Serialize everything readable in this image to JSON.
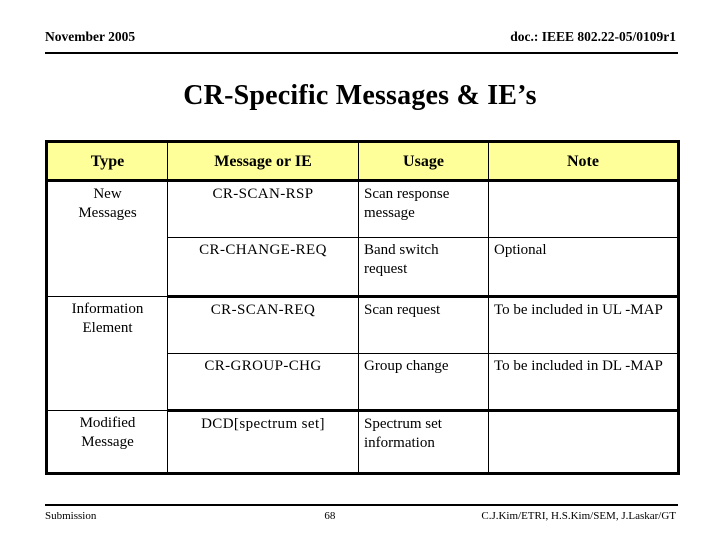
{
  "header": {
    "left": "November 2005",
    "right": "doc.: IEEE 802.22-05/0109r1"
  },
  "title": "CR-Specific Messages & IE’s",
  "table": {
    "columns": [
      "Type",
      "Message or IE",
      "Usage",
      "Note"
    ],
    "groups": [
      {
        "type": "New\nMessages",
        "type_line1": "New",
        "type_line2": "Messages",
        "rows": [
          {
            "message": "CR-SCAN-RSP",
            "usage": "Scan response message",
            "note": ""
          },
          {
            "message": "CR-CHANGE-REQ",
            "usage": "Band switch request",
            "note": "Optional"
          }
        ]
      },
      {
        "type": "Information\nElement",
        "type_line1": "Information",
        "type_line2": "Element",
        "rows": [
          {
            "message": "CR-SCAN-REQ",
            "usage": "Scan request",
            "note": "To be included in UL -MAP"
          },
          {
            "message": "CR-GROUP-CHG",
            "usage": "Group change",
            "note": "To be included in DL -MAP"
          }
        ]
      },
      {
        "type": "Modified\nMessage",
        "type_line1": "Modified",
        "type_line2": "Message",
        "rows": [
          {
            "message": "DCD[spectrum set]",
            "usage": "Spectrum set information",
            "note": ""
          }
        ]
      }
    ],
    "colors": {
      "header_fill": "#ffff99",
      "type_fill": "#ffff99",
      "border": "#000000",
      "mono_text": "#14143c"
    }
  },
  "footer": {
    "left": "Submission",
    "page": "68",
    "right": "C.J.Kim/ETRI, H.S.Kim/SEM, J.Laskar/GT"
  }
}
